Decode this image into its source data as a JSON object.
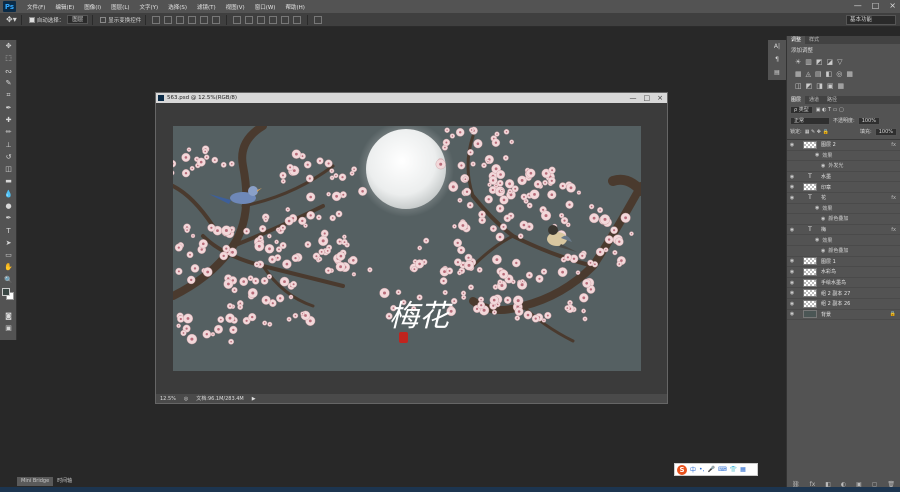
{
  "app": {
    "logo": "Ps"
  },
  "menu": [
    "文件(F)",
    "编辑(E)",
    "图像(I)",
    "图层(L)",
    "文字(Y)",
    "选择(S)",
    "滤镜(T)",
    "视图(V)",
    "窗口(W)",
    "帮助(H)"
  ],
  "window_controls": [
    "—",
    "□",
    "×"
  ],
  "options": {
    "auto_select_label": "自动选择：",
    "auto_select_value": "图层",
    "show_transform_label": "显示变换控件",
    "workspace": "基本功能"
  },
  "document": {
    "title": "563.psd @ 12.5%(RGB/8)",
    "controls": [
      "—",
      "□",
      "×"
    ],
    "zoom": "12.5%",
    "doc_info": "文档:96.1M/283.4M"
  },
  "artwork": {
    "background": "#556062",
    "blossom_color": "#f2d8da",
    "moon_color": "#f3f4f4",
    "calligraphy": "梅花",
    "seal_color": "#c0241e"
  },
  "right_strip": [
    "A|",
    "¶"
  ],
  "adjust_panel": {
    "tabs": [
      "调整",
      "样式"
    ],
    "title": "添加调整",
    "icon_rows": [
      [
        "☀",
        "▥",
        "◩",
        "◪",
        "▽"
      ],
      [
        "▦",
        "◬",
        "▤",
        "◧",
        "◎",
        "▦"
      ],
      [
        "◫",
        "◩",
        "◨",
        "▣",
        "▦"
      ]
    ]
  },
  "layers_panel": {
    "tabs": [
      "图层",
      "通道",
      "路径"
    ],
    "kind": "ρ 类型",
    "blend": "正常",
    "opacity_label": "不透明度:",
    "opacity": "100%",
    "lock_label": "锁定:",
    "fill_label": "填充:",
    "fill": "100%",
    "layers": [
      {
        "name": "图层 2",
        "type": "pixel",
        "fx": "fx"
      },
      {
        "name": "效果",
        "type": "sub"
      },
      {
        "name": "外发光",
        "type": "sub2"
      },
      {
        "name": "水墨",
        "type": "text",
        "fx": ""
      },
      {
        "name": "印章",
        "type": "pixel",
        "fx": ""
      },
      {
        "name": "花",
        "type": "text",
        "fx": "fx"
      },
      {
        "name": "效果",
        "type": "sub"
      },
      {
        "name": "颜色叠加",
        "type": "sub2"
      },
      {
        "name": "梅",
        "type": "text",
        "fx": "fx"
      },
      {
        "name": "效果",
        "type": "sub"
      },
      {
        "name": "颜色叠加",
        "type": "sub2"
      },
      {
        "name": "图层 1",
        "type": "pixel",
        "fx": ""
      },
      {
        "name": "水彩鸟",
        "type": "pixel",
        "fx": ""
      },
      {
        "name": "手绘水墨鸟",
        "type": "pixel",
        "fx": ""
      },
      {
        "name": "组 2 副本 27",
        "type": "pixel",
        "fx": ""
      },
      {
        "name": "组 2 副本 26",
        "type": "pixel",
        "fx": ""
      },
      {
        "name": "背景",
        "type": "background",
        "fx": "🔒"
      }
    ],
    "footer": [
      "⛓",
      "fx",
      "◧",
      "◐",
      "▣",
      "▢",
      "🗑"
    ]
  },
  "bottom_tabs": [
    "Mini Bridge",
    "时间轴"
  ],
  "ime": {
    "logo": "S",
    "items": [
      "中",
      "•,",
      "🎤",
      "⌨",
      "👕",
      "▦"
    ]
  }
}
